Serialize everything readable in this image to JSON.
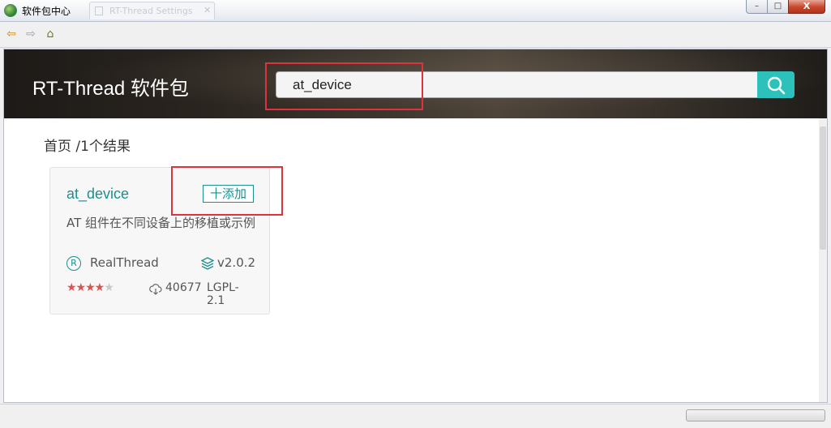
{
  "window": {
    "title": "软件包中心",
    "background_tab": "RT-Thread Settings",
    "controls": {
      "minimize": "–",
      "maximize": "□",
      "close": "X"
    }
  },
  "toolbar": {
    "back_icon": "back-arrow-icon",
    "forward_icon": "forward-arrow-icon",
    "home_icon": "home-icon"
  },
  "header": {
    "brand": "RT-Thread 软件包",
    "search": {
      "value": "at_device",
      "icon": "search-icon"
    }
  },
  "breadcrumb": "首页 /1个结果",
  "results": [
    {
      "name": "at_device",
      "add_label": "十添加",
      "description": "AT 组件在不同设备上的移植或示例",
      "author_badge": "R",
      "author": "RealThread",
      "version": "v2.0.2",
      "rating": 4.5,
      "rating_stars": "★★★★",
      "rating_half": "★",
      "downloads": "40677",
      "license": "LGPL-2.1"
    }
  ],
  "colors": {
    "accent": "#1e8f8c",
    "search_button": "#2cc2bb",
    "highlight": "#e0323a",
    "stars": "#d9534f"
  }
}
